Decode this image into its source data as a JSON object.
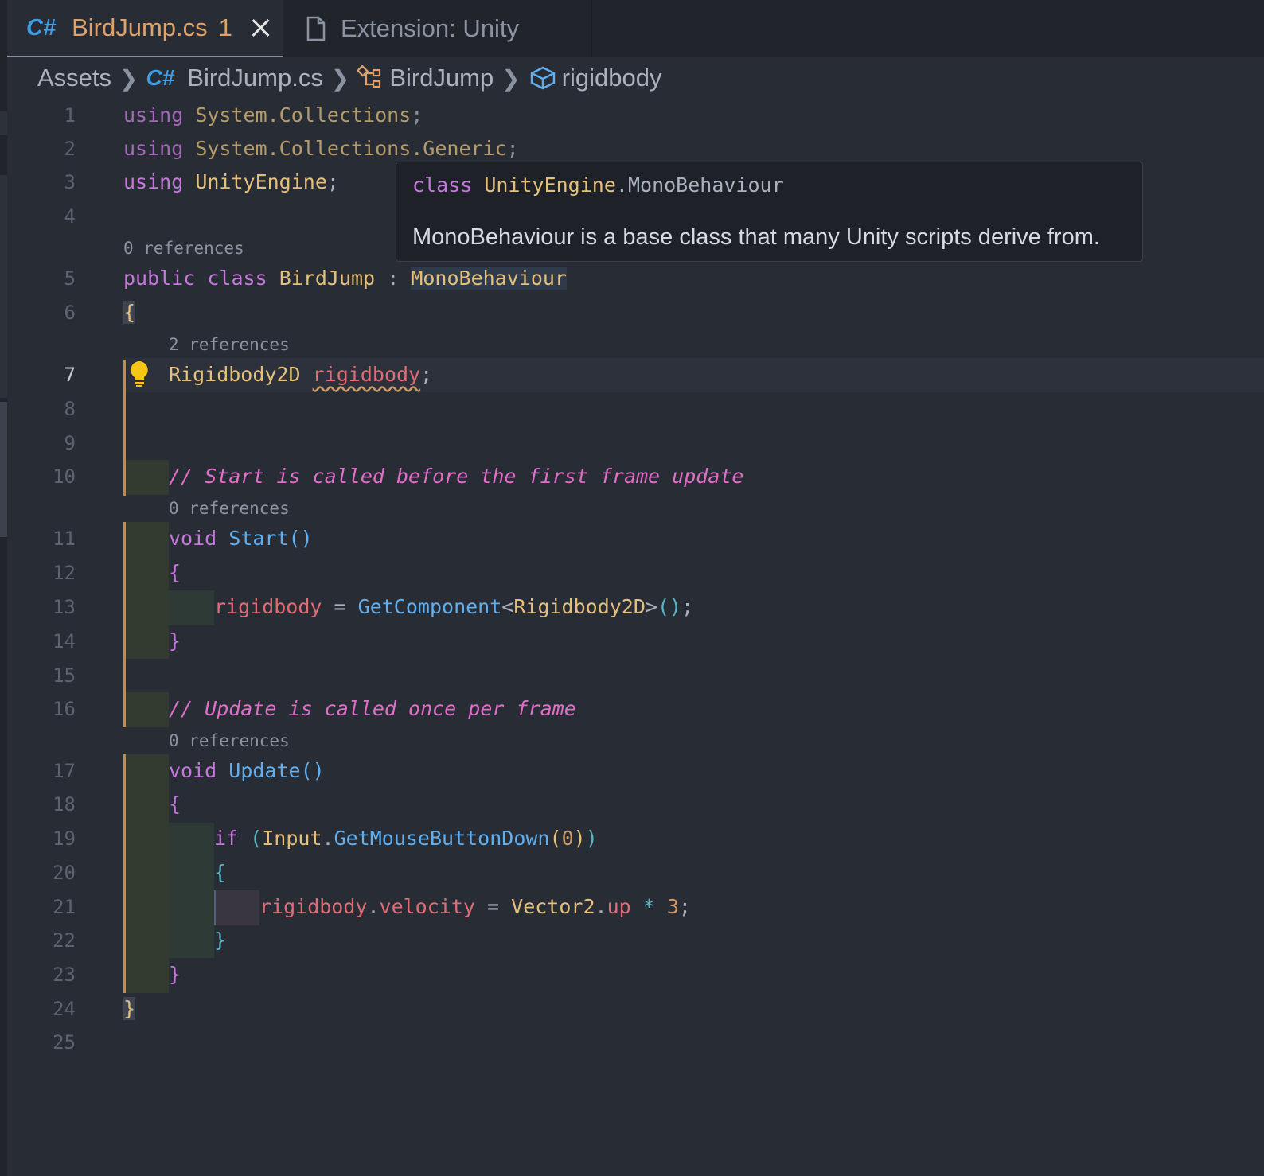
{
  "tabs": [
    {
      "badge": "C#",
      "name": "BirdJump.cs",
      "problems": "1",
      "active": true
    },
    {
      "icon": "file-icon",
      "name": "Extension: Unity",
      "active": false
    }
  ],
  "breadcrumb": {
    "folder": "Assets",
    "file_badge": "C#",
    "file": "BirdJump.cs",
    "class": "BirdJump",
    "member": "rigidbody"
  },
  "line_numbers": [
    "1",
    "2",
    "3",
    "4",
    "5",
    "6",
    "7",
    "8",
    "9",
    "10",
    "11",
    "12",
    "13",
    "14",
    "15",
    "16",
    "17",
    "18",
    "19",
    "20",
    "21",
    "22",
    "23",
    "24",
    "25"
  ],
  "active_line": "7",
  "code_lens": {
    "class": "0 references",
    "field": "2 references",
    "start": "0 references",
    "update": "0 references"
  },
  "code": {
    "l1": {
      "kw": "using",
      "ns": "System.Collections",
      "semi": ";"
    },
    "l2": {
      "kw": "using",
      "ns": "System.Collections.Generic",
      "semi": ";"
    },
    "l3": {
      "kw": "using",
      "ns": "UnityEngine",
      "semi": ";"
    },
    "l5": {
      "mod": "public",
      "kw": "class",
      "name": "BirdJump",
      "colon": ":",
      "base": "MonoBehaviour"
    },
    "l6": "{",
    "l7": {
      "type": "Rigidbody2D",
      "name": "rigidbody",
      "semi": ";"
    },
    "l10": "// Start is called before the first frame update",
    "l11": {
      "kw": "void",
      "fn": "Start",
      "parens": "()"
    },
    "l12": "{",
    "l13": {
      "var": "rigidbody",
      "eq": "=",
      "fn": "GetComponent",
      "lt": "<",
      "type": "Rigidbody2D",
      "gt": ">",
      "parens": "()",
      "semi": ";"
    },
    "l14": "}",
    "l16": "// Update is called once per frame",
    "l17": {
      "kw": "void",
      "fn": "Update",
      "parens": "()"
    },
    "l18": "{",
    "l19": {
      "kw": "if",
      "open": "(",
      "cls": "Input",
      "dot": ".",
      "fn": "GetMouseButtonDown",
      "popen": "(",
      "arg": "0",
      "pclose": ")",
      "close": ")"
    },
    "l20": "{",
    "l21": {
      "var": "rigidbody",
      "dot": ".",
      "prop": "velocity",
      "eq": "=",
      "cls": "Vector2",
      "dot2": ".",
      "member": "up",
      "op": "*",
      "num": "3",
      "semi": ";"
    },
    "l22": "}",
    "l23": "}",
    "l24": "}"
  },
  "hover": {
    "kw": "class",
    "ns": "UnityEngine",
    "dot": ".",
    "name": "MonoBehaviour",
    "doc": "MonoBehaviour is a base class that many Unity scripts derive from."
  },
  "colors": {
    "editor_bg": "#282c34",
    "keyword": "#c678dd",
    "type": "#e5c07b",
    "function": "#61afef",
    "variable": "#e06c75",
    "number": "#d19a66",
    "comment": "#e06fca",
    "tab_accent": "#e0a26a",
    "csharp_badge": "#3d9ee6",
    "indent_guide": "#c7894a",
    "lightbulb": "#f5c518"
  }
}
